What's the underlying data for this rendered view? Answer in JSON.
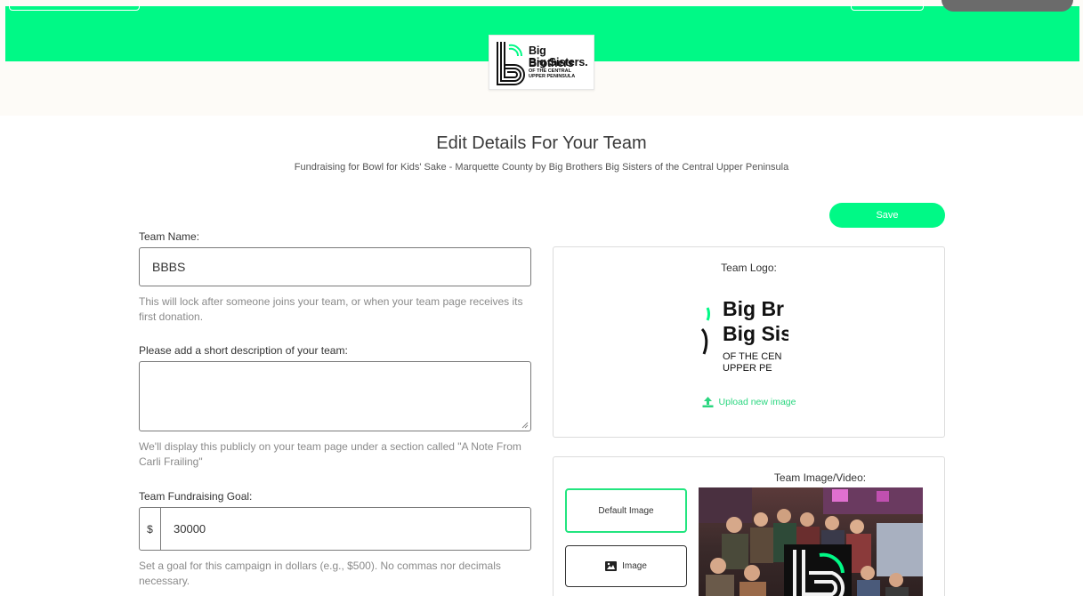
{
  "org": {
    "logo_line1": "Big Brothers",
    "logo_line2": "Big Sisters.",
    "logo_sub": "OF THE CENTRAL UPPER PENINSULA"
  },
  "page": {
    "title": "Edit Details For Your Team",
    "subtitle": "Fundraising for Bowl for Kids' Sake - Marquette County by Big Brothers Big Sisters of the Central Upper Peninsula"
  },
  "actions": {
    "save_label": "Save"
  },
  "form": {
    "team_name": {
      "label": "Team Name:",
      "value": "BBBS",
      "help": "This will lock after someone joins your team, or when your team page receives its first donation."
    },
    "description": {
      "label": "Please add a short description of your team:",
      "value": "",
      "help": "We'll display this publicly on your team page under a section called \"A Note From Carli Frailing\""
    },
    "goal": {
      "label": "Team Fundraising Goal:",
      "prefix": "$",
      "value": "30000",
      "help": "Set a goal for this campaign in dollars (e.g., $500). No commas nor decimals necessary."
    }
  },
  "logo_card": {
    "title": "Team Logo:",
    "preview_line1": "Big Br",
    "preview_line2": "Big Sis",
    "preview_line3": "OF THE CEN",
    "preview_line4": "UPPER PE",
    "upload_label": "Upload new image",
    "upload_icon": "upload-icon"
  },
  "media_card": {
    "title": "Team Image/Video:",
    "default_label": "Default Image",
    "image_label": "Image",
    "image_icon": "image-icon"
  },
  "colors": {
    "brand_green": "#00f986",
    "link_green": "#2ad67f",
    "header_band": "#fdfbf7"
  }
}
